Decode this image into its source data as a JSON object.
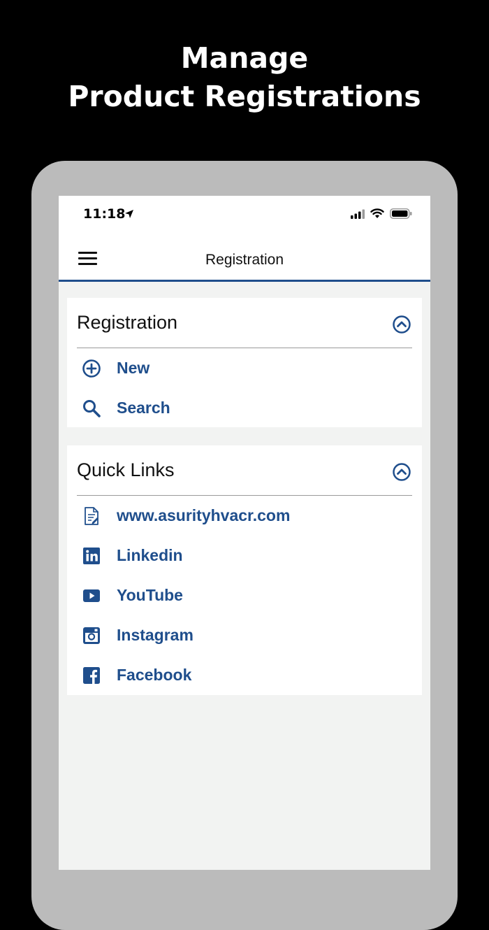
{
  "headline": {
    "line1": "Manage",
    "line2": "Product Registrations"
  },
  "status_bar": {
    "time": "11:18",
    "icons": [
      "location-arrow-icon",
      "signal-icon",
      "wifi-icon",
      "battery-icon"
    ]
  },
  "app_bar": {
    "title": "Registration",
    "menu_icon": "hamburger-menu-icon"
  },
  "colors": {
    "accent": "#1f4e8c",
    "page_bg": "#000000",
    "device_frame": "#bbbbbb",
    "screen_bg": "#f2f3f2"
  },
  "registration_card": {
    "title": "Registration",
    "collapse_icon": "chevron-up-circle-icon",
    "items": [
      {
        "label": "New",
        "icon": "plus-circle-icon"
      },
      {
        "label": "Search",
        "icon": "search-icon"
      }
    ]
  },
  "quick_links_card": {
    "title": "Quick Links",
    "collapse_icon": "chevron-up-circle-icon",
    "items": [
      {
        "label": "www.asurityhvacr.com",
        "icon": "document-icon"
      },
      {
        "label": "Linkedin",
        "icon": "linkedin-icon"
      },
      {
        "label": "YouTube",
        "icon": "youtube-icon"
      },
      {
        "label": "Instagram",
        "icon": "instagram-icon"
      },
      {
        "label": "Facebook",
        "icon": "facebook-icon"
      }
    ]
  }
}
